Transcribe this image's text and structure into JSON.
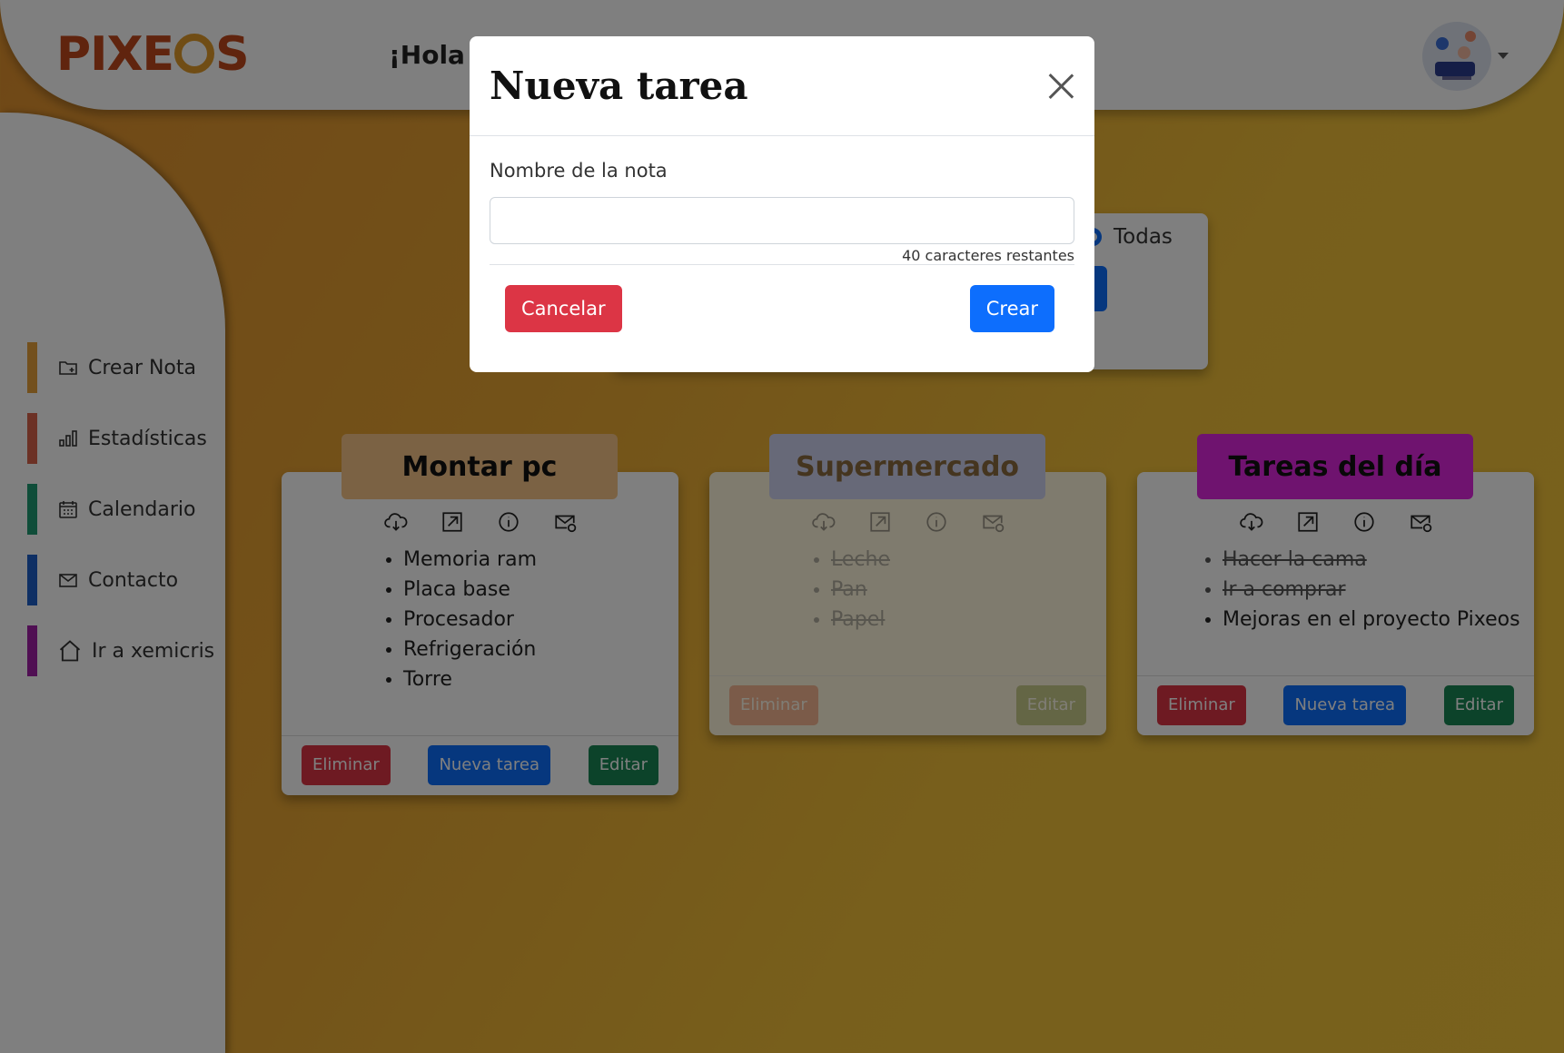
{
  "header": {
    "logo_text_left": "PIXE",
    "logo_text_right": "S",
    "greeting": "¡Hola d"
  },
  "sidebar": {
    "items": [
      {
        "label": "Crear Nota",
        "color": "#e6a03a"
      },
      {
        "label": "Estadísticas",
        "color": "#d9624b"
      },
      {
        "label": "Calendario",
        "color": "#1f9a73"
      },
      {
        "label": "Contacto",
        "color": "#1c5fc9"
      },
      {
        "label": "Ir a xemicris",
        "color": "#a01ea6"
      }
    ]
  },
  "filter": {
    "radio_label": "Todas"
  },
  "notes": [
    {
      "title": "Montar pc",
      "color": "#f6c588",
      "tasks": [
        {
          "text": "Memoria ram",
          "done": false
        },
        {
          "text": "Placa base",
          "done": false
        },
        {
          "text": "Procesador",
          "done": false
        },
        {
          "text": "Refrigeración",
          "done": false
        },
        {
          "text": "Torre",
          "done": false
        }
      ],
      "buttons": {
        "delete": "Eliminar",
        "new_task": "Nueva tarea",
        "edit": "Editar"
      }
    },
    {
      "title": "Supermercado",
      "color": "#cfd3f0",
      "tasks": [
        {
          "text": "Leche",
          "done": true
        },
        {
          "text": "Pan",
          "done": true
        },
        {
          "text": "Papel",
          "done": true
        }
      ],
      "buttons": {
        "delete": "Eliminar",
        "edit": "Editar"
      }
    },
    {
      "title": "Tareas del día",
      "color": "#de26de",
      "tasks": [
        {
          "text": "Hacer la cama",
          "done": true
        },
        {
          "text": "Ir a comprar",
          "done": true
        },
        {
          "text": "Mejoras en el proyecto Pixeos",
          "done": false
        }
      ],
      "buttons": {
        "delete": "Eliminar",
        "new_task": "Nueva tarea",
        "edit": "Editar"
      }
    }
  ],
  "modal": {
    "title": "Nueva tarea",
    "field_label": "Nombre de la nota",
    "input_value": "",
    "counter": "40 caracteres restantes",
    "cancel": "Cancelar",
    "create": "Crear"
  }
}
